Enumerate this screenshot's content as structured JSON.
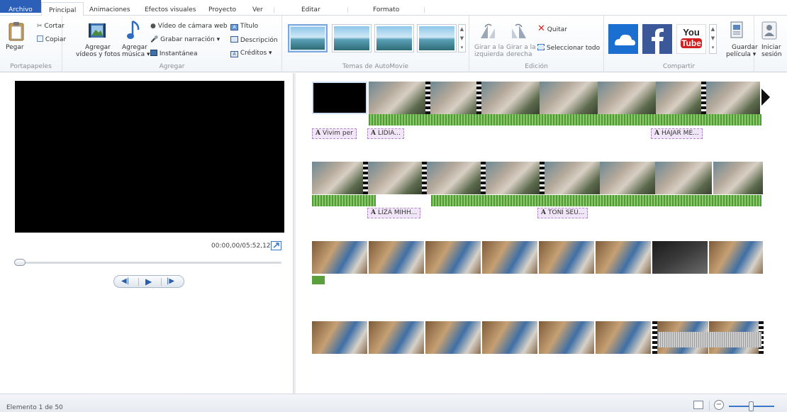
{
  "tabs": {
    "file": "Archivo",
    "home": "Principal",
    "animations": "Animaciones",
    "visual_effects": "Efectos visuales",
    "project": "Proyecto",
    "view": "Ver",
    "edit": "Editar",
    "format": "Formato"
  },
  "ribbon": {
    "clipboard": {
      "label": "Portapapeles",
      "paste": "Pegar",
      "cut": "Cortar",
      "copy": "Copiar"
    },
    "add": {
      "label": "Agregar",
      "add_videos_line1": "Agregar",
      "add_videos_line2": "vídeos y fotos",
      "add_music_line1": "Agregar",
      "add_music_line2": "música",
      "webcam_video": "Vídeo de cámara web",
      "record_narration": "Grabar narración",
      "snapshot": "Instantánea",
      "title": "Título",
      "caption": "Descripción",
      "credits": "Créditos"
    },
    "automovie": {
      "label": "Temas de AutoMovie"
    },
    "editing": {
      "label": "Edición",
      "rotate_left_line1": "Girar a la",
      "rotate_left_line2": "izquierda",
      "rotate_right_line1": "Girar a la",
      "rotate_right_line2": "derecha",
      "remove": "Quitar",
      "select_all": "Seleccionar todo"
    },
    "share": {
      "label": "Compartir",
      "youtube_you": "You",
      "youtube_tube": "Tube",
      "save_movie_line1": "Guardar",
      "save_movie_line2": "película",
      "sign_in_line1": "Iniciar",
      "sign_in_line2": "sesión"
    }
  },
  "preview": {
    "timecode": "00:00,00/05:52,12"
  },
  "storyboard": {
    "captions": [
      "Vivim per",
      "LIDIA...",
      "HAJAR ME...",
      "LIZA MIHH...",
      "TONI SEU..."
    ]
  },
  "status": {
    "item_count": "Elemento 1 de 50"
  },
  "colors": {
    "file_tab": "#2b5fb8",
    "accent": "#3a77c7",
    "audio_wave": "#4f9a3a",
    "caption_bg": "#f1e6f8"
  }
}
